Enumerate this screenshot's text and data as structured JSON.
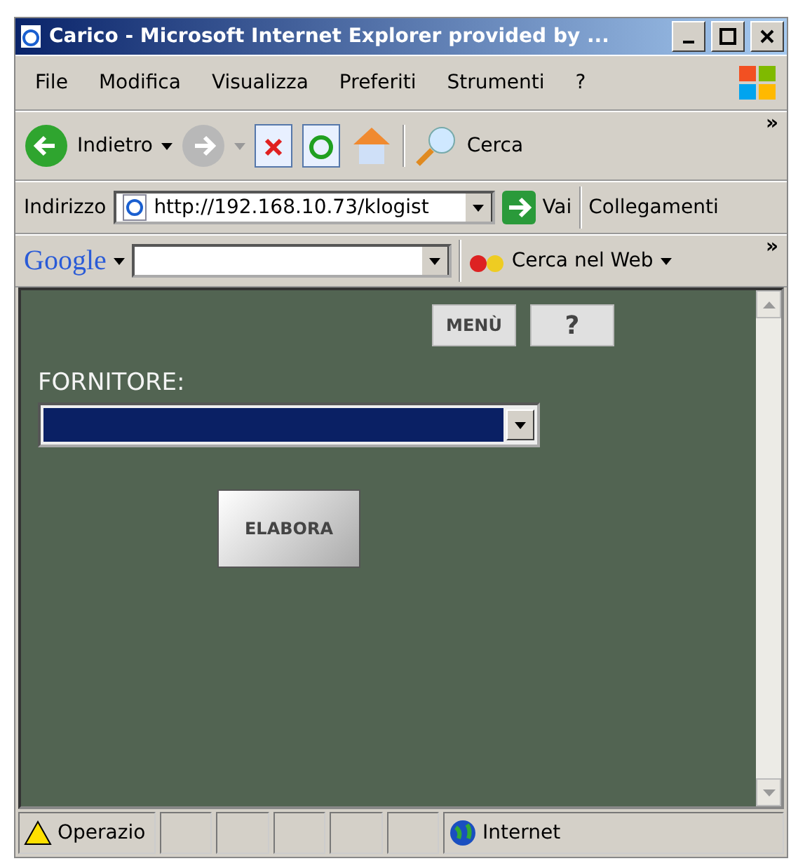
{
  "window": {
    "title": "Carico - Microsoft Internet Explorer provided by ..."
  },
  "menu": [
    "File",
    "Modifica",
    "Visualizza",
    "Preferiti",
    "Strumenti",
    "?"
  ],
  "toolbar": {
    "back": "Indietro",
    "search": "Cerca",
    "more": "»"
  },
  "address": {
    "label": "Indirizzo",
    "value": "http://192.168.10.73/klogist",
    "go": "Vai",
    "links": "Collegamenti"
  },
  "google": {
    "logo": "Google",
    "search_web": "Cerca nel Web",
    "more": "»"
  },
  "page": {
    "menu_button": "MENÙ",
    "help_button": "?",
    "field_label": "FORNITORE:",
    "submit": "ELABORA"
  },
  "status_bar": {
    "message": "Operazio",
    "zone": "Internet"
  }
}
